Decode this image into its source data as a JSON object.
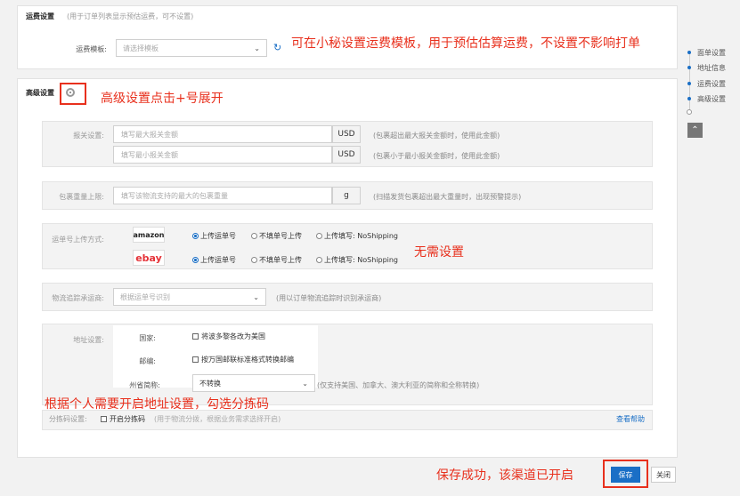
{
  "shipping": {
    "title": "运费设置",
    "note": "(用于订单列表显示预估运费，可不设置)",
    "template_label": "运费模板:",
    "template_placeholder": "请选择模板",
    "annotation": "可在小秘设置运费模板，用于预估估算运费，不设置不影响打单"
  },
  "advanced": {
    "title": "高级设置",
    "annotation": "高级设置点击+号展开",
    "declare": {
      "label": "报关设置:",
      "max_placeholder": "填写最大报关金额",
      "min_placeholder": "填写最小报关金额",
      "currency": "USD",
      "max_hint": "(包裹超出最大报关金额时，使用此金额)",
      "min_hint": "(包裹小于最小报关金额时，使用此金额)"
    },
    "weight": {
      "label": "包裹重量上限:",
      "placeholder": "填写该物流支持的最大的包裹重量",
      "unit": "g",
      "hint": "(扫描发货包裹超出最大重量时，出现预警提示)"
    },
    "upload": {
      "label": "运单号上传方式:",
      "amazon": "amazon",
      "ebay": "ebay",
      "opt1": "上传运单号",
      "opt2": "不填单号上传",
      "opt3": "上传填写: NoShipping",
      "annotation": "无需设置"
    },
    "tracking": {
      "label": "物流追踪承运商:",
      "placeholder": "根据运单号识别",
      "hint": "(用以订单物流追踪时识别承运商)"
    },
    "address": {
      "label": "地址设置:",
      "country_label": "国家:",
      "country_opt": "将波多黎各改为美国",
      "zip_label": "邮编:",
      "zip_opt": "按万国邮联标准格式转换邮编",
      "state_label": "州省简称:",
      "state_value": "不转换",
      "state_hint": "(仅支持美国、加拿大、澳大利亚的简称和全称转换)"
    },
    "sort_annotation": "根据个人需要开启地址设置，勾选分拣码",
    "sort": {
      "label": "分拣码设置:",
      "opt": "开启分拣码",
      "hint": "(用于物流分拨，根据业务需求选择开启)",
      "help": "查看帮助"
    }
  },
  "nav": {
    "items": [
      "面单设置",
      "地址信息",
      "运费设置",
      "高级设置"
    ]
  },
  "footer": {
    "annotation": "保存成功，该渠道已开启",
    "save": "保存",
    "close": "关闭"
  },
  "colors": {
    "accent": "#1a6fc6",
    "annotation": "#e8301d"
  }
}
